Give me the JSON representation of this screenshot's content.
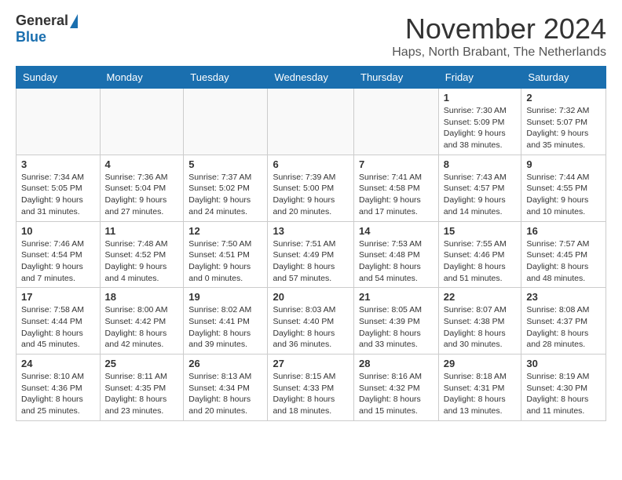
{
  "header": {
    "logo_general": "General",
    "logo_blue": "Blue",
    "month_title": "November 2024",
    "location": "Haps, North Brabant, The Netherlands"
  },
  "days_of_week": [
    "Sunday",
    "Monday",
    "Tuesday",
    "Wednesday",
    "Thursday",
    "Friday",
    "Saturday"
  ],
  "weeks": [
    [
      {
        "day": "",
        "info": ""
      },
      {
        "day": "",
        "info": ""
      },
      {
        "day": "",
        "info": ""
      },
      {
        "day": "",
        "info": ""
      },
      {
        "day": "",
        "info": ""
      },
      {
        "day": "1",
        "info": "Sunrise: 7:30 AM\nSunset: 5:09 PM\nDaylight: 9 hours and 38 minutes."
      },
      {
        "day": "2",
        "info": "Sunrise: 7:32 AM\nSunset: 5:07 PM\nDaylight: 9 hours and 35 minutes."
      }
    ],
    [
      {
        "day": "3",
        "info": "Sunrise: 7:34 AM\nSunset: 5:05 PM\nDaylight: 9 hours and 31 minutes."
      },
      {
        "day": "4",
        "info": "Sunrise: 7:36 AM\nSunset: 5:04 PM\nDaylight: 9 hours and 27 minutes."
      },
      {
        "day": "5",
        "info": "Sunrise: 7:37 AM\nSunset: 5:02 PM\nDaylight: 9 hours and 24 minutes."
      },
      {
        "day": "6",
        "info": "Sunrise: 7:39 AM\nSunset: 5:00 PM\nDaylight: 9 hours and 20 minutes."
      },
      {
        "day": "7",
        "info": "Sunrise: 7:41 AM\nSunset: 4:58 PM\nDaylight: 9 hours and 17 minutes."
      },
      {
        "day": "8",
        "info": "Sunrise: 7:43 AM\nSunset: 4:57 PM\nDaylight: 9 hours and 14 minutes."
      },
      {
        "day": "9",
        "info": "Sunrise: 7:44 AM\nSunset: 4:55 PM\nDaylight: 9 hours and 10 minutes."
      }
    ],
    [
      {
        "day": "10",
        "info": "Sunrise: 7:46 AM\nSunset: 4:54 PM\nDaylight: 9 hours and 7 minutes."
      },
      {
        "day": "11",
        "info": "Sunrise: 7:48 AM\nSunset: 4:52 PM\nDaylight: 9 hours and 4 minutes."
      },
      {
        "day": "12",
        "info": "Sunrise: 7:50 AM\nSunset: 4:51 PM\nDaylight: 9 hours and 0 minutes."
      },
      {
        "day": "13",
        "info": "Sunrise: 7:51 AM\nSunset: 4:49 PM\nDaylight: 8 hours and 57 minutes."
      },
      {
        "day": "14",
        "info": "Sunrise: 7:53 AM\nSunset: 4:48 PM\nDaylight: 8 hours and 54 minutes."
      },
      {
        "day": "15",
        "info": "Sunrise: 7:55 AM\nSunset: 4:46 PM\nDaylight: 8 hours and 51 minutes."
      },
      {
        "day": "16",
        "info": "Sunrise: 7:57 AM\nSunset: 4:45 PM\nDaylight: 8 hours and 48 minutes."
      }
    ],
    [
      {
        "day": "17",
        "info": "Sunrise: 7:58 AM\nSunset: 4:44 PM\nDaylight: 8 hours and 45 minutes."
      },
      {
        "day": "18",
        "info": "Sunrise: 8:00 AM\nSunset: 4:42 PM\nDaylight: 8 hours and 42 minutes."
      },
      {
        "day": "19",
        "info": "Sunrise: 8:02 AM\nSunset: 4:41 PM\nDaylight: 8 hours and 39 minutes."
      },
      {
        "day": "20",
        "info": "Sunrise: 8:03 AM\nSunset: 4:40 PM\nDaylight: 8 hours and 36 minutes."
      },
      {
        "day": "21",
        "info": "Sunrise: 8:05 AM\nSunset: 4:39 PM\nDaylight: 8 hours and 33 minutes."
      },
      {
        "day": "22",
        "info": "Sunrise: 8:07 AM\nSunset: 4:38 PM\nDaylight: 8 hours and 30 minutes."
      },
      {
        "day": "23",
        "info": "Sunrise: 8:08 AM\nSunset: 4:37 PM\nDaylight: 8 hours and 28 minutes."
      }
    ],
    [
      {
        "day": "24",
        "info": "Sunrise: 8:10 AM\nSunset: 4:36 PM\nDaylight: 8 hours and 25 minutes."
      },
      {
        "day": "25",
        "info": "Sunrise: 8:11 AM\nSunset: 4:35 PM\nDaylight: 8 hours and 23 minutes."
      },
      {
        "day": "26",
        "info": "Sunrise: 8:13 AM\nSunset: 4:34 PM\nDaylight: 8 hours and 20 minutes."
      },
      {
        "day": "27",
        "info": "Sunrise: 8:15 AM\nSunset: 4:33 PM\nDaylight: 8 hours and 18 minutes."
      },
      {
        "day": "28",
        "info": "Sunrise: 8:16 AM\nSunset: 4:32 PM\nDaylight: 8 hours and 15 minutes."
      },
      {
        "day": "29",
        "info": "Sunrise: 8:18 AM\nSunset: 4:31 PM\nDaylight: 8 hours and 13 minutes."
      },
      {
        "day": "30",
        "info": "Sunrise: 8:19 AM\nSunset: 4:30 PM\nDaylight: 8 hours and 11 minutes."
      }
    ]
  ]
}
